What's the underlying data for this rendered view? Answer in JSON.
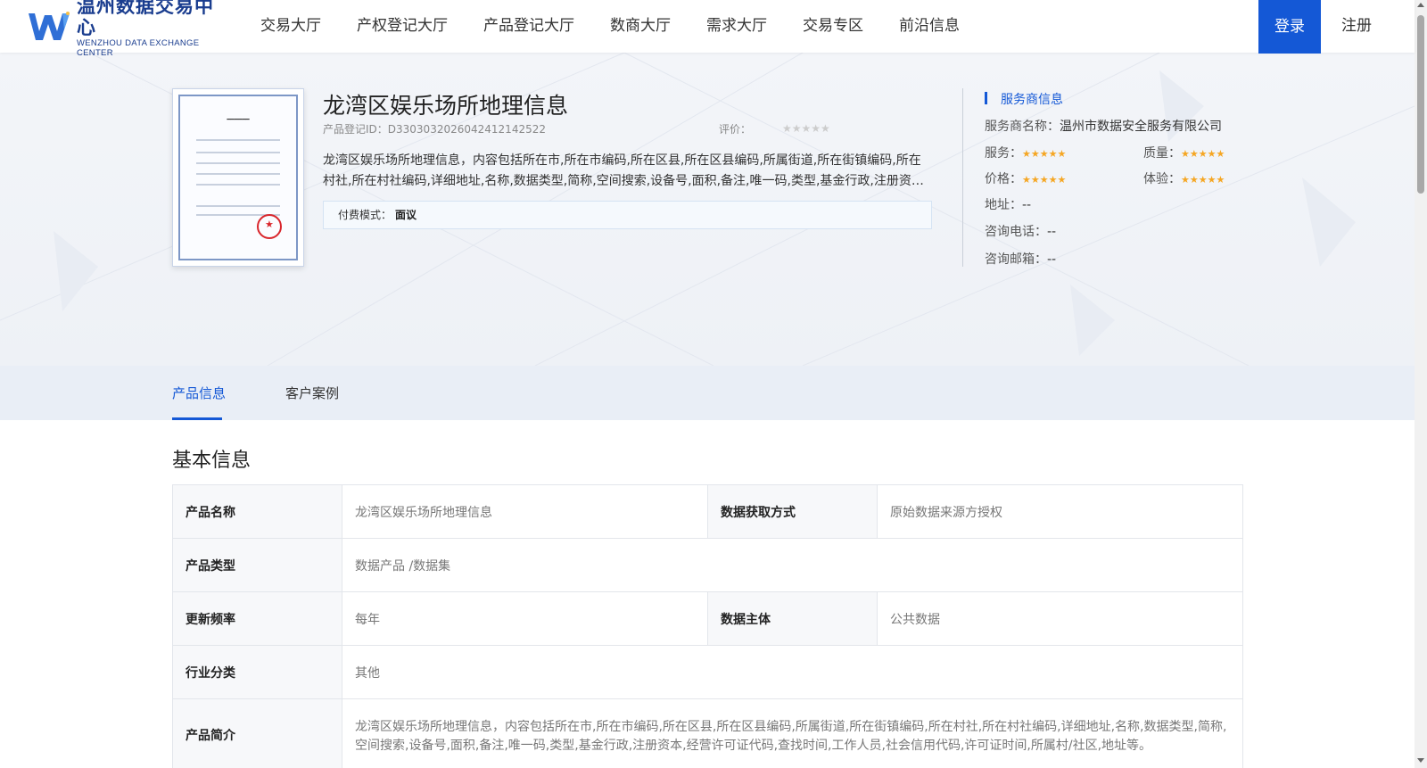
{
  "header": {
    "logo_cn": "温州数据交易中心",
    "logo_en": "WENZHOU DATA EXCHANGE CENTER",
    "nav": [
      "交易大厅",
      "产权登记大厅",
      "产品登记大厅",
      "数商大厅",
      "需求大厅",
      "交易专区",
      "前沿信息"
    ],
    "login_label": "登录",
    "register_label": "注册",
    "accent_color": "#1458d6"
  },
  "product": {
    "title": "龙湾区娱乐场所地理信息",
    "id_label": "产品登记ID：",
    "id_value": "D33030320260424121425​22",
    "rating_label": "评价：",
    "rating_stars": "★★★★★",
    "description": "龙湾区娱乐场所地理信息，内容包括所在市,所在市编码,所在区县,所在区县编码,所属街道,所在街镇编码,所在村社,所在村社编码,详细地址,名称,数据类型,简称,空间搜索,设备号,面积,备注,唯一码,类型,基金行政,注册资本,经营许可证代码,查找时间,工作人员,社会信用代码,许可证时间,所属村/社区,地址等。",
    "pay_label": "付费模式：",
    "pay_value": "面议"
  },
  "provider": {
    "heading": "服务商信息",
    "name_label": "服务商名称：",
    "name_value": "温州市数据安全服务有限公司",
    "service_label": "服务：",
    "quality_label": "质量：",
    "price_label": "价格：",
    "experience_label": "体验：",
    "stars": "★★★★★",
    "address_label": "地址：",
    "address_value": "--",
    "phone_label": "咨询电话：",
    "phone_value": "--",
    "email_label": "咨询邮箱：",
    "email_value": "--"
  },
  "tabs": [
    "产品信息",
    "客户案例"
  ],
  "basic_info": {
    "title": "基本信息",
    "product_name_label": "产品名称",
    "product_name_value": "龙湾区娱乐场所地理信息",
    "acquire_label": "数据获取方式",
    "acquire_value": "原始数据来源方授权",
    "type_label": "产品类型",
    "type_value": "数据产品 /数据集",
    "freq_label": "更新频率",
    "freq_value": "每年",
    "subject_label": "数据主体",
    "subject_value": "公共数据",
    "industry_label": "行业分类",
    "industry_value": "其他",
    "intro_label": "产品简介",
    "intro_value": "龙湾区娱乐场所地理信息，内容包括所在市,所在市编码,所在区县,所在区县编码,所属街道,所在街镇编码,所在村社,所在村社编码,详细地址,名称,数据类型,简称,空间搜索,设备号,面积,备注,唯一码,类型,基金行政,注册资本,经营许可证代码,查找时间,工作人员,社会信用代码,许可证时间,所属村/社区,地址等。"
  }
}
